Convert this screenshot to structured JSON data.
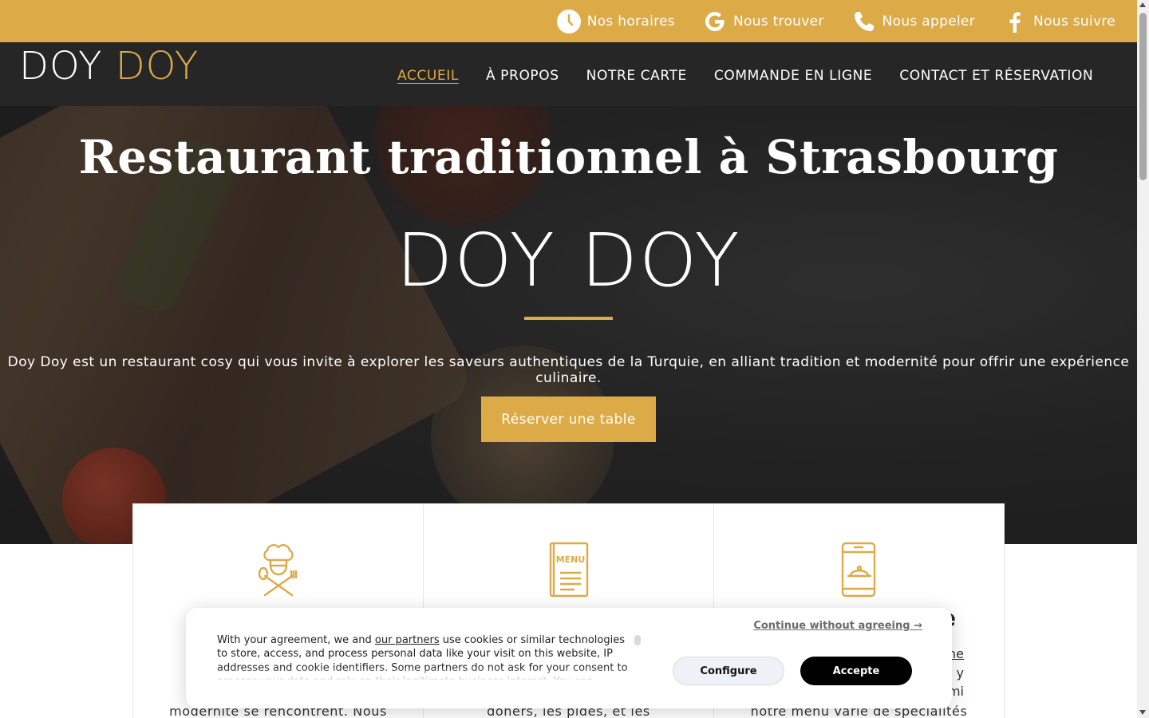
{
  "topbar": {
    "links": [
      {
        "label": "Nos horaires",
        "icon": "clock-icon"
      },
      {
        "label": "Nous trouver",
        "icon": "google-icon"
      },
      {
        "label": "Nous appeler",
        "icon": "phone-icon"
      },
      {
        "label": "Nous suivre",
        "icon": "facebook-icon"
      }
    ]
  },
  "brand": {
    "part1": "DOY",
    "part2": "DOY"
  },
  "nav": {
    "items": [
      {
        "label": "ACCUEIL",
        "active": true
      },
      {
        "label": "À PROPOS"
      },
      {
        "label": "NOTRE CARTE"
      },
      {
        "label": "COMMANDE EN LIGNE"
      },
      {
        "label": "CONTACT ET RÉSERVATION"
      }
    ]
  },
  "hero": {
    "title": "Restaurant traditionnel à Strasbourg",
    "brand": "DOY DOY",
    "text": "Doy Doy est un restaurant cosy qui vous invite à explorer les saveurs authentiques de la Turquie, en alliant tradition et modernité pour offrir une expérience culinaire.",
    "button": "Réserver une table"
  },
  "cards": [
    {
      "icon": "chef-icon",
      "title": "",
      "text": "modernité se rencontrent. Nous"
    },
    {
      "icon": "menu-icon",
      "title": "",
      "text": "doners, les pides, et les"
    },
    {
      "icon": "phone-delivery-icon",
      "title": "e",
      "link": "ne",
      "line2": "y",
      "line3": "mi",
      "text": "notre menu varié de spécialités"
    }
  ],
  "cookie": {
    "text_before": "With your agreement, we and ",
    "partners": "our partners",
    "text_after": " use cookies or similar technologies to store, access, and process personal data like your visit on this website, IP addresses and cookie identifiers. Some partners do not ask for your consent to process your data and rely on their legitimate business interest. You can",
    "continue": "Continue without agreeing →",
    "configure": "Configure",
    "accept": "Accepte"
  },
  "colors": {
    "accent": "#dcab47",
    "nav_bg": "#262626"
  }
}
